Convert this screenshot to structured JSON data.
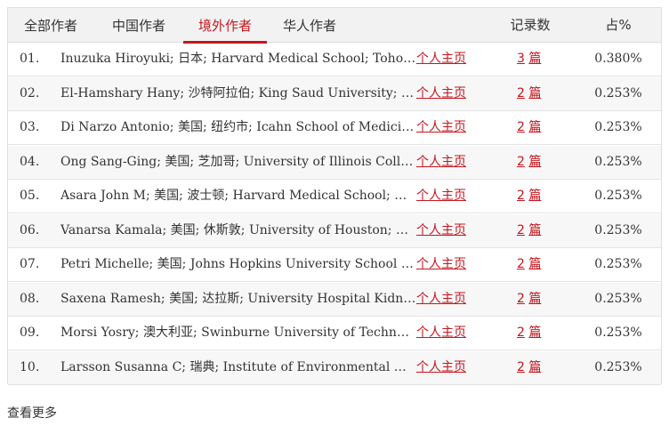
{
  "tabs": [
    {
      "label": "全部作者",
      "active": false
    },
    {
      "label": "中国作者",
      "active": false
    },
    {
      "label": "境外作者",
      "active": true
    },
    {
      "label": "华人作者",
      "active": false
    }
  ],
  "columns": {
    "records": "记录数",
    "percent": "占%"
  },
  "home_label": "个人主页",
  "unit": "篇",
  "rows": [
    {
      "rank": "01.",
      "name": "Inuzuka Hiroyuki; 日本; Harvard Medical School; Tohoku ...",
      "count": "3",
      "percent": "0.380%"
    },
    {
      "rank": "02.",
      "name": "El-Hamshary Hany; 沙特阿拉伯; King Saud University; Ki...",
      "count": "2",
      "percent": "0.253%"
    },
    {
      "rank": "03.",
      "name": "Di Narzo Antonio; 美国; 纽约市; Icahn School of Medicine ...",
      "count": "2",
      "percent": "0.253%"
    },
    {
      "rank": "04.",
      "name": "Ong Sang-Ging; 美国; 芝加哥; University of Illinois Colleg...",
      "count": "2",
      "percent": "0.253%"
    },
    {
      "rank": "05.",
      "name": "Asara John M; 美国; 波士顿; Harvard Medical School; Geo...",
      "count": "2",
      "percent": "0.253%"
    },
    {
      "rank": "06.",
      "name": "Vanarsa Kamala; 美国; 休斯敦; University of Houston; 科...",
      "count": "2",
      "percent": "0.253%"
    },
    {
      "rank": "07.",
      "name": "Petri Michelle; 美国; Johns Hopkins University School of ...",
      "count": "2",
      "percent": "0.253%"
    },
    {
      "rank": "08.",
      "name": "Saxena Ramesh; 美国; 达拉斯; University Hospital Kidney...",
      "count": "2",
      "percent": "0.253%"
    },
    {
      "rank": "09.",
      "name": "Morsi Yosry; 澳大利亚; Swinburne University of Technolo...",
      "count": "2",
      "percent": "0.253%"
    },
    {
      "rank": "10.",
      "name": "Larsson Susanna C; 瑞典; Institute of Environmental Medi...",
      "count": "2",
      "percent": "0.253%"
    }
  ],
  "more_label": "查看更多",
  "colors": {
    "accent": "#c4171f",
    "header_bg": "#f2f2f2",
    "alt_row_bg": "#f7f7f7"
  }
}
